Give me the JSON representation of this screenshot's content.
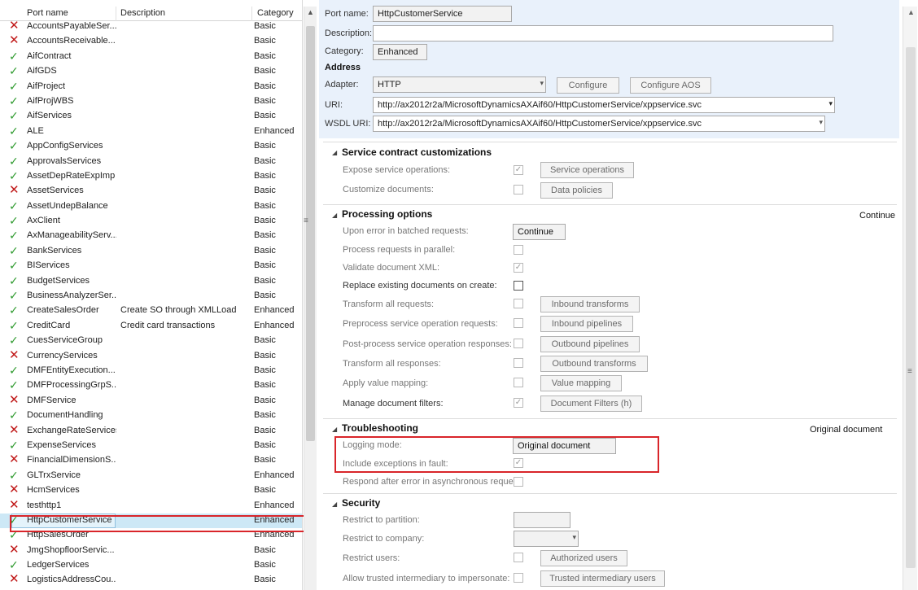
{
  "grid": {
    "columns": [
      "Port name",
      "Description",
      "Category"
    ],
    "rows": [
      {
        "status": "error",
        "name": "AccountsPayableSer...",
        "description": "",
        "category": "Basic"
      },
      {
        "status": "error",
        "name": "AccountsReceivable...",
        "description": "",
        "category": "Basic"
      },
      {
        "status": "ok",
        "name": "AifContract",
        "description": "",
        "category": "Basic"
      },
      {
        "status": "ok",
        "name": "AifGDS",
        "description": "",
        "category": "Basic"
      },
      {
        "status": "ok",
        "name": "AifProject",
        "description": "",
        "category": "Basic"
      },
      {
        "status": "ok",
        "name": "AifProjWBS",
        "description": "",
        "category": "Basic"
      },
      {
        "status": "ok",
        "name": "AifServices",
        "description": "",
        "category": "Basic"
      },
      {
        "status": "ok",
        "name": "ALE",
        "description": "",
        "category": "Enhanced"
      },
      {
        "status": "ok",
        "name": "AppConfigServices",
        "description": "",
        "category": "Basic"
      },
      {
        "status": "ok",
        "name": "ApprovalsServices",
        "description": "",
        "category": "Basic"
      },
      {
        "status": "ok",
        "name": "AssetDepRateExpImp",
        "description": "",
        "category": "Basic"
      },
      {
        "status": "error",
        "name": "AssetServices",
        "description": "",
        "category": "Basic"
      },
      {
        "status": "ok",
        "name": "AssetUndepBalance",
        "description": "",
        "category": "Basic"
      },
      {
        "status": "ok",
        "name": "AxClient",
        "description": "",
        "category": "Basic"
      },
      {
        "status": "ok",
        "name": "AxManageabilityServ...",
        "description": "",
        "category": "Basic"
      },
      {
        "status": "ok",
        "name": "BankServices",
        "description": "",
        "category": "Basic"
      },
      {
        "status": "ok",
        "name": "BIServices",
        "description": "",
        "category": "Basic"
      },
      {
        "status": "ok",
        "name": "BudgetServices",
        "description": "",
        "category": "Basic"
      },
      {
        "status": "ok",
        "name": "BusinessAnalyzerSer...",
        "description": "",
        "category": "Basic"
      },
      {
        "status": "ok",
        "name": "CreateSalesOrder",
        "description": "Create SO through XMLLoad",
        "category": "Enhanced"
      },
      {
        "status": "ok",
        "name": "CreditCard",
        "description": "Credit card transactions",
        "category": "Enhanced"
      },
      {
        "status": "ok",
        "name": "CuesServiceGroup",
        "description": "",
        "category": "Basic"
      },
      {
        "status": "error",
        "name": "CurrencyServices",
        "description": "",
        "category": "Basic"
      },
      {
        "status": "ok",
        "name": "DMFEntityExecution...",
        "description": "",
        "category": "Basic"
      },
      {
        "status": "ok",
        "name": "DMFProcessingGrpS...",
        "description": "",
        "category": "Basic"
      },
      {
        "status": "error",
        "name": "DMFService",
        "description": "",
        "category": "Basic"
      },
      {
        "status": "ok",
        "name": "DocumentHandling",
        "description": "",
        "category": "Basic"
      },
      {
        "status": "error",
        "name": "ExchangeRateServices",
        "description": "",
        "category": "Basic"
      },
      {
        "status": "ok",
        "name": "ExpenseServices",
        "description": "",
        "category": "Basic"
      },
      {
        "status": "error",
        "name": "FinancialDimensionS...",
        "description": "",
        "category": "Basic"
      },
      {
        "status": "ok",
        "name": "GLTrxService",
        "description": "",
        "category": "Enhanced"
      },
      {
        "status": "error",
        "name": "HcmServices",
        "description": "",
        "category": "Basic"
      },
      {
        "status": "error",
        "name": "testhttp1",
        "description": "",
        "category": "Enhanced"
      },
      {
        "status": "ok",
        "name": "HttpCustomerService",
        "description": "",
        "category": "Enhanced",
        "selected": true
      },
      {
        "status": "ok",
        "name": "HttpSalesOrder",
        "description": "",
        "category": "Enhanced"
      },
      {
        "status": "error",
        "name": "JmgShopfloorServic...",
        "description": "",
        "category": "Basic"
      },
      {
        "status": "ok",
        "name": "LedgerServices",
        "description": "",
        "category": "Basic"
      },
      {
        "status": "error",
        "name": "LogisticsAddressCou...",
        "description": "",
        "category": "Basic"
      }
    ]
  },
  "form": {
    "port_name_label": "Port name:",
    "port_name_value": "HttpCustomerService",
    "description_label": "Description:",
    "description_value": "",
    "category_label": "Category:",
    "category_value": "Enhanced",
    "address_heading": "Address",
    "adapter_label": "Adapter:",
    "adapter_value": "HTTP",
    "configure_label": "Configure",
    "configure_aos_label": "Configure AOS",
    "uri_label": "URI:",
    "uri_value": "http://ax2012r2a/MicrosoftDynamicsAXAif60/HttpCustomerService/xppservice.svc",
    "wsdl_label": "WSDL URI:",
    "wsdl_value": "http://ax2012r2a/MicrosoftDynamicsAXAif60/HttpCustomerService/xppservice.svc"
  },
  "service_contract": {
    "title": "Service contract customizations",
    "expose_label": "Expose service operations:",
    "expose_checked": true,
    "service_ops_button": "Service operations",
    "customize_docs_label": "Customize documents:",
    "customize_docs_checked": false,
    "data_policies_button": "Data policies"
  },
  "processing": {
    "title": "Processing options",
    "summary": "Continue",
    "upon_error_label": "Upon error in batched requests:",
    "upon_error_value": "Continue",
    "parallel_label": "Process requests in parallel:",
    "validate_label": "Validate document XML:",
    "replace_label": "Replace existing documents on create:",
    "transform_all_requests_label": "Transform all requests:",
    "inbound_transforms_button": "Inbound transforms",
    "preprocess_label": "Preprocess service operation requests:",
    "inbound_pipelines_button": "Inbound pipelines",
    "postprocess_label": "Post-process service operation responses:",
    "outbound_pipelines_button": "Outbound pipelines",
    "transform_all_responses_label": "Transform all responses:",
    "outbound_transforms_button": "Outbound transforms",
    "value_mapping_label": "Apply value mapping:",
    "value_mapping_button": "Value mapping",
    "doc_filters_label": "Manage document filters:",
    "doc_filters_button": "Document Filters (h)"
  },
  "troubleshooting": {
    "title": "Troubleshooting",
    "summary": "Original document",
    "logging_label": "Logging mode:",
    "logging_value": "Original document",
    "exceptions_label": "Include exceptions in fault:",
    "respond_label": "Respond after error in asynchronous request:"
  },
  "security": {
    "title": "Security",
    "partition_label": "Restrict to partition:",
    "company_label": "Restrict to company:",
    "users_label": "Restrict users:",
    "authorized_users_button": "Authorized users",
    "intermediary_label": "Allow trusted intermediary to impersonate:",
    "trusted_intermediary_button": "Trusted intermediary users"
  },
  "icons": {
    "ok": "check-icon",
    "error": "cross-icon"
  },
  "colors": {
    "ok": "#2e9a2e",
    "error": "#c01818",
    "highlight": "#d9252a",
    "selection": "#cde8f6"
  }
}
